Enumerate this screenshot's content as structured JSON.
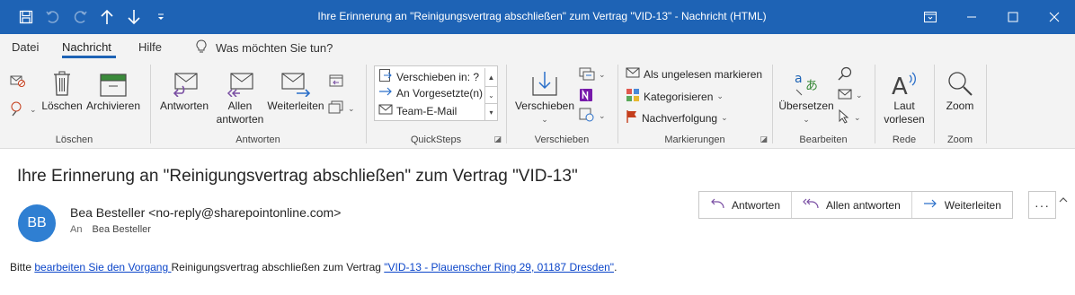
{
  "window": {
    "title": "Ihre Erinnerung an \"Reinigungsvertrag abschließen\" zum Vertrag \"VID-13\"  -  Nachricht (HTML)",
    "accent": "#1e63b5"
  },
  "quick_access": {
    "icons": [
      "save-icon",
      "undo-icon",
      "redo-icon",
      "arrow-up-icon",
      "arrow-down-icon",
      "customize-qat-icon"
    ]
  },
  "tabs": [
    {
      "label": "Datei"
    },
    {
      "label": "Nachricht",
      "active": true
    },
    {
      "label": "Hilfe"
    }
  ],
  "tell_me": {
    "placeholder": "Was möchten Sie tun?"
  },
  "ribbon": {
    "loeschen": {
      "label": "Löschen",
      "delete_label": "Löschen",
      "archive_label": "Archivieren"
    },
    "antworten": {
      "label": "Antworten",
      "reply_label": "Antworten",
      "reply_all_line1": "Allen",
      "reply_all_line2": "antworten",
      "forward_label": "Weiterleiten"
    },
    "quicksteps": {
      "label": "QuickSteps",
      "items": [
        "Verschieben in: ?",
        "An Vorgesetzte(n)",
        "Team-E-Mail"
      ]
    },
    "verschieben": {
      "label": "Verschieben",
      "move_label": "Verschieben"
    },
    "markierungen": {
      "label": "Markierungen",
      "unread_label": "Als ungelesen markieren",
      "categorize_label": "Kategorisieren",
      "followup_label": "Nachverfolgung"
    },
    "bearbeiten": {
      "label": "Bearbeiten",
      "translate_label": "Übersetzen"
    },
    "rede": {
      "label": "Rede",
      "read_line1": "Laut",
      "read_line2": "vorlesen"
    },
    "zoom": {
      "label": "Zoom",
      "zoom_label": "Zoom"
    }
  },
  "message": {
    "subject": "Ihre Erinnerung an \"Reinigungsvertrag abschließen\" zum Vertrag \"VID-13\"",
    "avatar_initials": "BB",
    "avatar_color": "#2f7fd2",
    "sender": "Bea Besteller <no-reply@sharepointonline.com>",
    "to_label": "An",
    "to_name": "Bea Besteller",
    "actions": {
      "reply": "Antworten",
      "reply_all": "Allen antworten",
      "forward": "Weiterleiten",
      "more": "···"
    },
    "body": {
      "text1": "Bitte ",
      "link1": "bearbeiten Sie den Vorgang ",
      "text2": "Reinigungsvertrag abschließen zum Vertrag ",
      "link2": "\"VID-13 - Plauenscher Ring 29, 01187 Dresden\"",
      "text3": "."
    }
  }
}
